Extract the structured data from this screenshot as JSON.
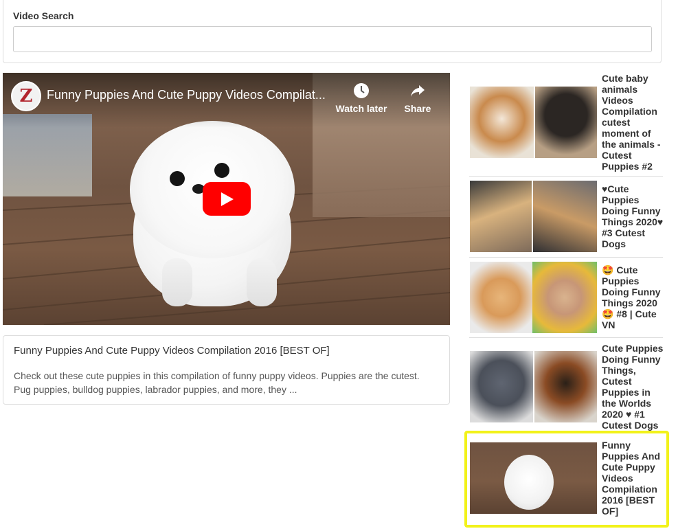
{
  "search": {
    "label": "Video Search",
    "value": "",
    "placeholder": ""
  },
  "player": {
    "channel_initial": "Z",
    "title": "Funny Puppies And Cute Puppy Videos Compilat...",
    "watch_later_label": "Watch later",
    "share_label": "Share"
  },
  "description": {
    "title": "Funny Puppies And Cute Puppy Videos Compilation 2016 [BEST OF]",
    "text": "Check out these cute puppies in this compilation of funny puppy videos. Puppies are the cutest. Pug puppies, bulldog puppies, labrador puppies, and more, they ..."
  },
  "related": [
    {
      "title": "Cute baby animals Videos Compilation cutest moment of the animals - Cutest Puppies #2",
      "colors": [
        "#c98a4d",
        "#2b2623"
      ]
    },
    {
      "title": "♥Cute Puppies Doing Funny Things 2020♥ #3 Cutest Dogs",
      "colors": [
        "#d8b27e",
        "#c99b66"
      ]
    },
    {
      "title": "🤩 Cute Puppies Doing Funny Things 2020 🤩 #8 | Cute VN",
      "colors": [
        "#e7b57a",
        "#d9b38e"
      ]
    },
    {
      "title": "Cute Puppies Doing Funny Things, Cutest Puppies in the Worlds 2020 ♥ #1 Cutest Dogs",
      "colors": [
        "#5f6571",
        "#2a2018"
      ]
    },
    {
      "title": "Funny Puppies And Cute Puppy Videos Compilation 2016 [BEST OF]",
      "colors": [
        "#7a5a44",
        "#7a5a44"
      ]
    }
  ],
  "colors": {
    "highlight": "#f2f21a",
    "play_button": "#ff0000"
  }
}
